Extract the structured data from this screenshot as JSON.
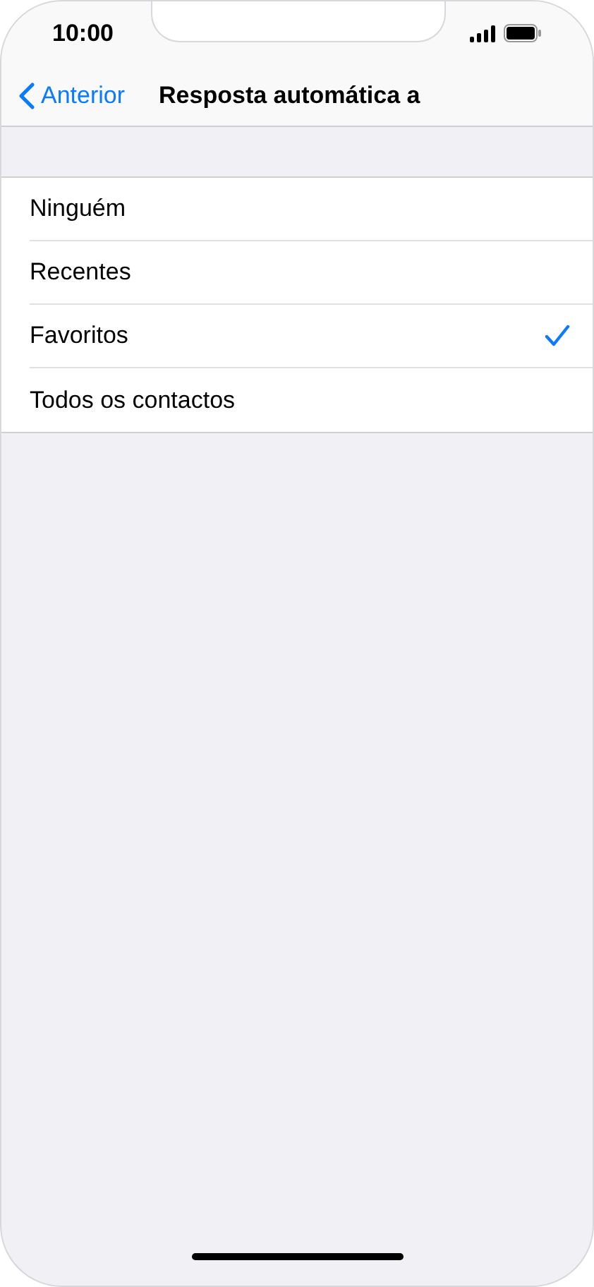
{
  "status_bar": {
    "time": "10:00"
  },
  "nav": {
    "back": "Anterior",
    "title": "Resposta automática a"
  },
  "options": [
    {
      "label": "Ninguém",
      "selected": false
    },
    {
      "label": "Recentes",
      "selected": false
    },
    {
      "label": "Favoritos",
      "selected": true
    },
    {
      "label": "Todos os contactos",
      "selected": false
    }
  ]
}
